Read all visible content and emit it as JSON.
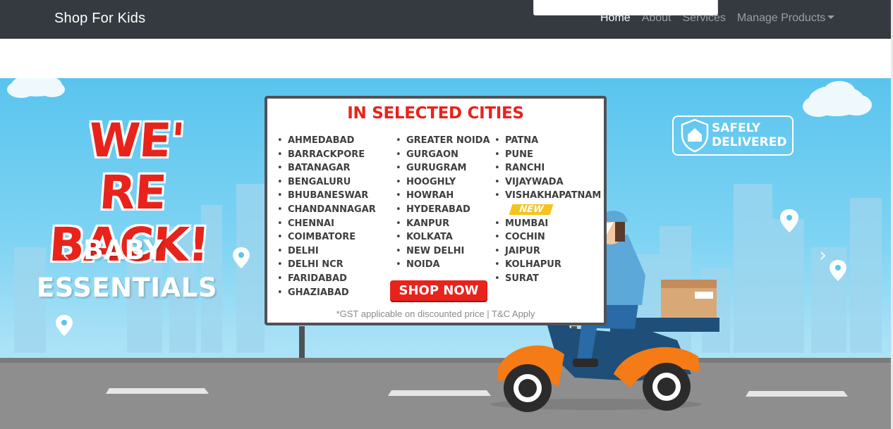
{
  "navbar": {
    "brand": "Shop For Kids",
    "links": [
      {
        "label": "Home",
        "active": true
      },
      {
        "label": "About",
        "active": false
      },
      {
        "label": "Services",
        "active": false
      },
      {
        "label": "Manage Products",
        "active": false,
        "dropdown": true
      }
    ]
  },
  "banner": {
    "headline": [
      "WE' RE",
      "BACK!"
    ],
    "subtitle": [
      "BABY",
      "ESSENTIALS"
    ],
    "board": {
      "title": "IN SELECTED CITIES",
      "columns": [
        [
          "AHMEDABAD",
          "BARRACKPORE",
          "BATANAGAR",
          "BENGALURU",
          "BHUBANESWAR",
          "CHANDANNAGAR",
          "CHENNAI",
          "COIMBATORE",
          "DELHI",
          "DELHI NCR",
          "FARIDABAD",
          "GHAZIABAD"
        ],
        [
          "GREATER NOIDA",
          "GURGAON",
          "GURUGRAM",
          "HOOGHLY",
          "HOWRAH",
          "HYDERABAD",
          "KANPUR",
          "KOLKATA",
          "NEW DELHI",
          "NOIDA"
        ],
        [
          "PATNA",
          "PUNE",
          "RANCHI",
          "VIJAYWADA",
          "VISHAKHAPATNAM"
        ],
        [
          "MUMBAI",
          "COCHIN",
          "JAIPUR",
          "KOLHAPUR",
          "SURAT"
        ]
      ],
      "new_badge": "NEW",
      "cta": "SHOP NOW",
      "disclaimer": "*GST applicable on discounted price |  T&C Apply"
    },
    "badge": [
      "SAFELY",
      "DELIVERED"
    ],
    "prev_icon": "chevron-left-icon",
    "next_icon": "chevron-right-icon",
    "colors": {
      "red": "#e8231c",
      "sky": "#5ac4ee",
      "navbar": "#343a40",
      "scooter_orange": "#f47b16",
      "scooter_blue": "#1f4e79"
    }
  }
}
